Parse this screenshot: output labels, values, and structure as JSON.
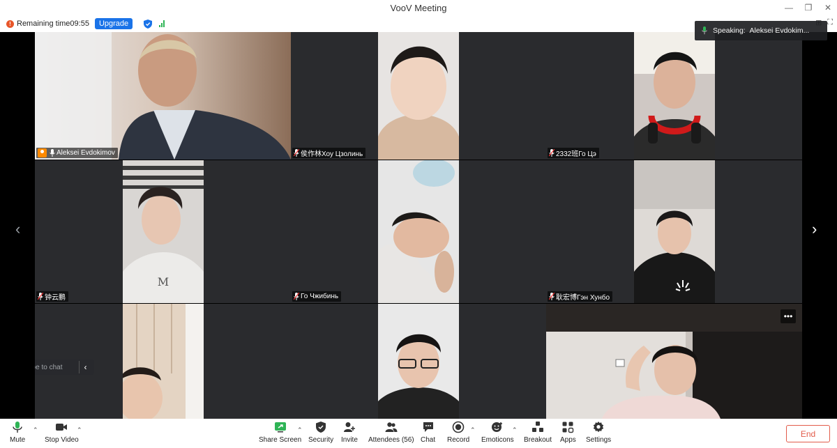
{
  "window": {
    "title": "VooV Meeting"
  },
  "infobar": {
    "remaining_label": "Remaining time",
    "remaining_time": "09:55",
    "upgrade_label": "Upgrade"
  },
  "speaking": {
    "label": "Speaking:",
    "name": "Aleksei Evdokim..."
  },
  "tiles": [
    {
      "name": "Aleksei Evdokimov",
      "host": true,
      "active": true
    },
    {
      "name": "侯作林Хоу Цзолинь"
    },
    {
      "name": "2332班Го Цэ"
    },
    {
      "name": "钟云鹏"
    },
    {
      "name": "Го Чжибинь"
    },
    {
      "name": "耿宏博Гэн Хунбо"
    },
    {
      "name": ""
    },
    {
      "name": ""
    },
    {
      "name": ""
    }
  ],
  "more_label": "•••",
  "chat": {
    "placeholder": "Type to chat"
  },
  "toolbar": {
    "mute": "Mute",
    "stop_video": "Stop Video",
    "share_screen": "Share Screen",
    "security": "Security",
    "invite": "Invite",
    "attendees": "Attendees (56)",
    "chat": "Chat",
    "record": "Record",
    "emoticons": "Emoticons",
    "breakout": "Breakout",
    "apps": "Apps",
    "settings": "Settings",
    "end": "End"
  },
  "colors": {
    "accent": "#1a73e8",
    "active_border": "#2fb456",
    "end": "#e25b4a"
  }
}
